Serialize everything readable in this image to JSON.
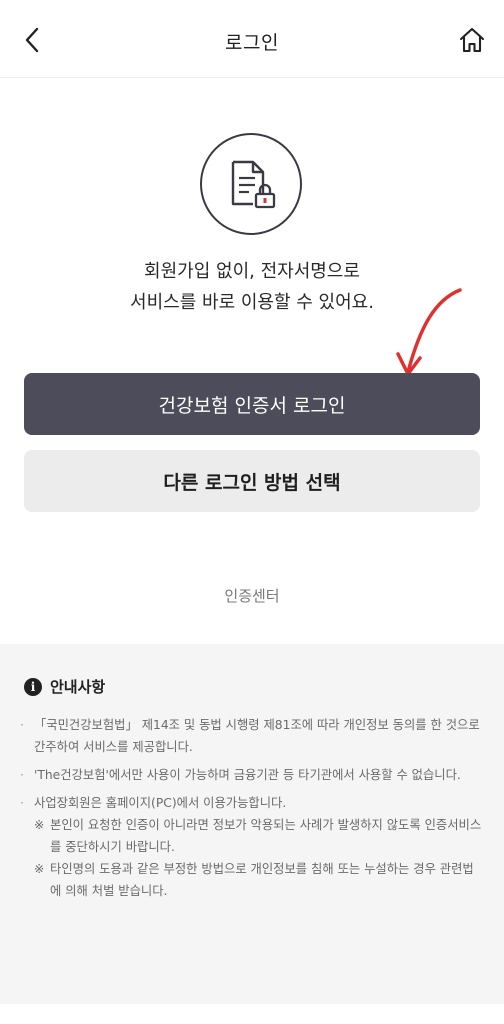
{
  "header": {
    "title": "로그인",
    "back_icon": "chevron-left-icon",
    "home_icon": "home-icon"
  },
  "intro": {
    "line1": "회원가입 없이, 전자서명으로",
    "line2": "서비스를 바로 이용할 수 있어요."
  },
  "buttons": {
    "cert_login": "건강보험 인증서 로그인",
    "other_login": "다른 로그인 방법 선택"
  },
  "cert_center": "인증센터",
  "notice": {
    "title": "안내사항",
    "info_icon_glyph": "i",
    "items": [
      "「국민건강보험법」 제14조 및 동법 시행령 제81조에 따라 개인정보 동의를 한 것으로 간주하여 서비스를 제공합니다.",
      "'The건강보험'에서만 사용이 가능하며 금융기관 등 타기관에서 사용할 수 없습니다.",
      "사업장회원은 홈페이지(PC)에서 이용가능합니다."
    ],
    "subitems": [
      "본인이 요청한 인증이 아니라면 정보가 악용되는 사례가 발생하지 않도록 인증서비스를 중단하시기 바랍니다.",
      "타인명의 도용과 같은 부정한 방법으로 개인정보를 침해 또는 누설하는 경우 관련법에 의해 처벌 받습니다."
    ],
    "bullet": "·",
    "sub_mark": "※"
  },
  "colors": {
    "primary_button": "#4d4c5b",
    "secondary_button": "#ececec",
    "annotation_arrow": "#e0302f",
    "lock_accent": "#e0302f"
  }
}
